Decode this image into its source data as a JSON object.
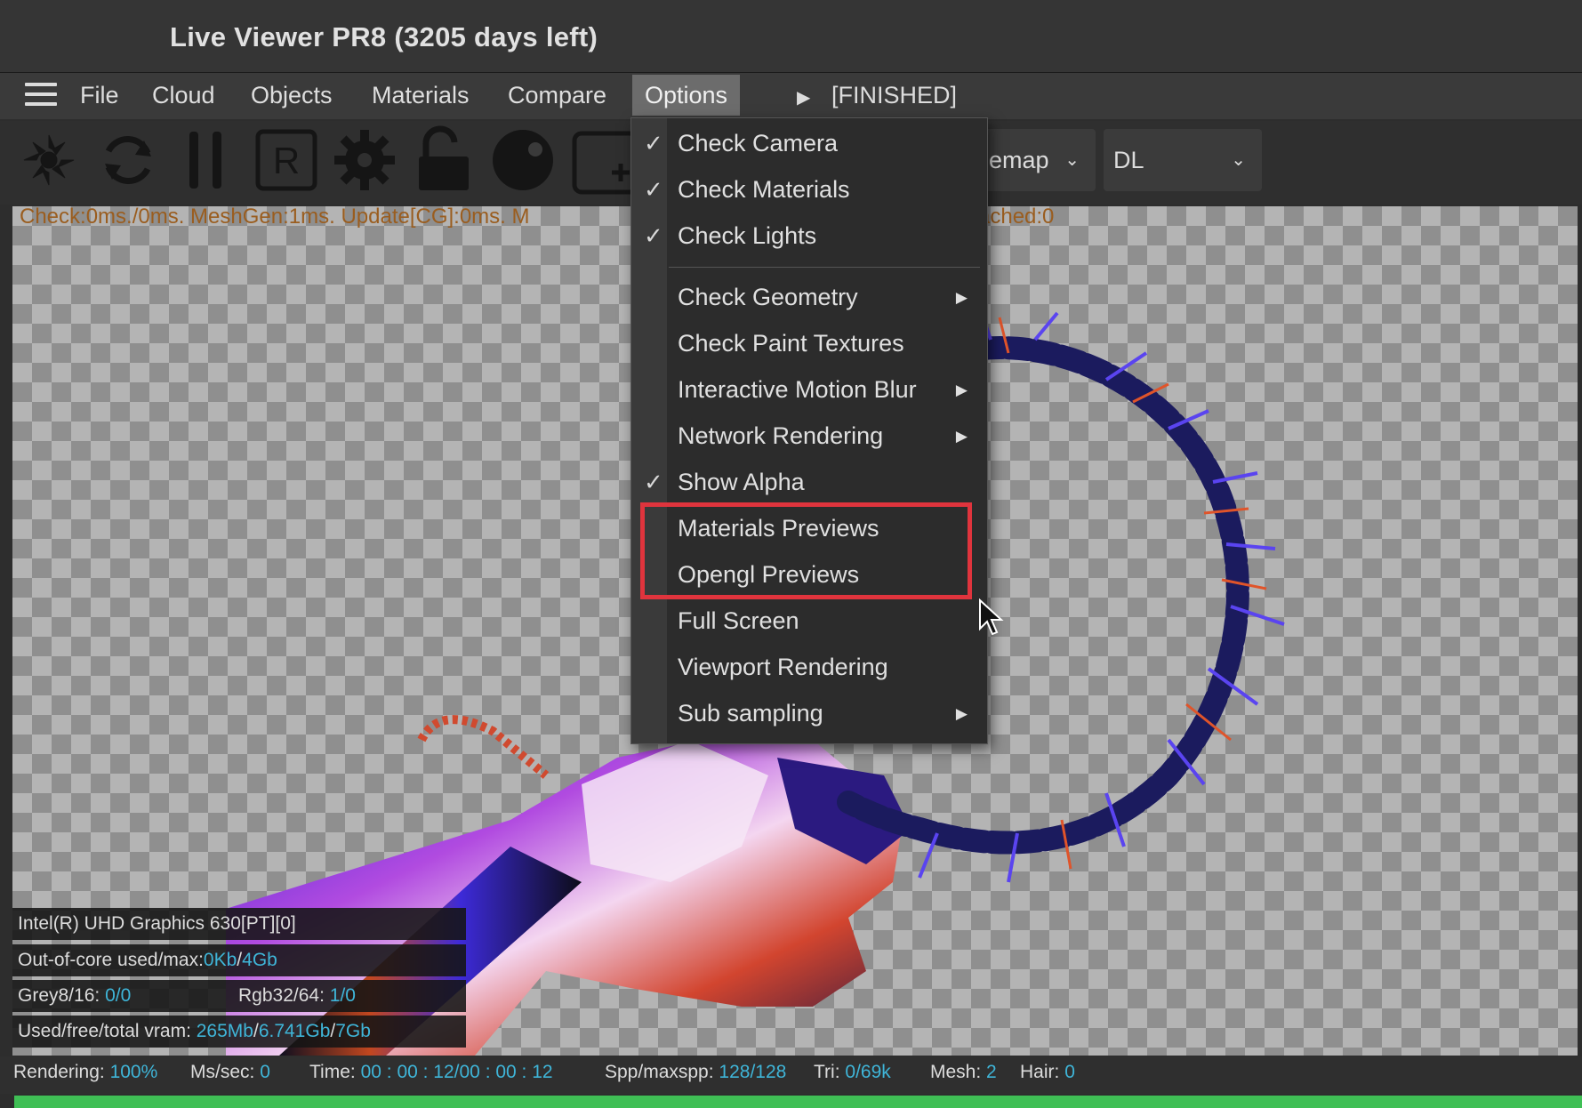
{
  "window": {
    "title": "Live Viewer PR8 (3205 days left)"
  },
  "menubar": {
    "items": [
      {
        "label": "File"
      },
      {
        "label": "Cloud"
      },
      {
        "label": "Objects"
      },
      {
        "label": "Materials"
      },
      {
        "label": "Compare"
      },
      {
        "label": "Options"
      }
    ],
    "active_item": "Options",
    "status": "[FINISHED]"
  },
  "toolbar": {
    "tools": [
      "reset-icon",
      "refresh-icon",
      "pause-icon",
      "region-render-icon",
      "settings-gear-icon",
      "unlock-icon",
      "material-ball-icon",
      "add-icon"
    ],
    "kernel_dropdown": {
      "value": "emap"
    },
    "mode_dropdown": {
      "value": "DL"
    }
  },
  "stats_top": "Check:0ms./0ms. MeshGen:1ms. Update[CG]:0ms. M",
  "stats_top_tail": "ached:0",
  "options_menu": {
    "items": [
      {
        "label": "Check Camera",
        "checked": true,
        "submenu": false
      },
      {
        "label": "Check Materials",
        "checked": true,
        "submenu": false
      },
      {
        "label": "Check Lights",
        "checked": true,
        "submenu": false
      },
      {
        "label": "Check Geometry",
        "checked": false,
        "submenu": true
      },
      {
        "label": "Check Paint Textures",
        "checked": false,
        "submenu": false
      },
      {
        "label": "Interactive Motion Blur",
        "checked": false,
        "submenu": true
      },
      {
        "label": "Network Rendering",
        "checked": false,
        "submenu": true
      },
      {
        "label": "Show Alpha",
        "checked": true,
        "submenu": false
      },
      {
        "label": "Materials Previews",
        "checked": false,
        "submenu": false
      },
      {
        "label": "Opengl Previews",
        "checked": false,
        "submenu": false
      },
      {
        "label": "Full Screen",
        "checked": false,
        "submenu": false
      },
      {
        "label": "Viewport Rendering",
        "checked": false,
        "submenu": false
      },
      {
        "label": "Sub sampling",
        "checked": false,
        "submenu": true
      }
    ],
    "highlighted": [
      "Materials Previews",
      "Opengl Previews"
    ],
    "highlight_color": "#e0343d"
  },
  "info": {
    "gpu": "Intel(R) UHD Graphics 630[PT][0]",
    "out_of_core_label": "Out-of-core used/max:",
    "out_of_core_used": "0Kb",
    "out_of_core_max": "4Gb",
    "grey_label": "Grey8/16:",
    "grey_value": "0/0",
    "rgb_label": "Rgb32/64:",
    "rgb_value": "1/0",
    "vram_label": "Used/free/total vram:",
    "vram_used": "265Mb",
    "vram_free": "6.741Gb",
    "vram_total": "7Gb"
  },
  "status_bar": {
    "rendering_label": "Rendering:",
    "rendering_value": "100%",
    "ms_label": "Ms/sec:",
    "ms_value": "0",
    "time_label": "Time:",
    "time_value": "00 : 00 : 12/00 : 00 : 12",
    "spp_label": "Spp/maxspp:",
    "spp_value": "128/128",
    "tri_label": "Tri:",
    "tri_value": "0/69k",
    "mesh_label": "Mesh:",
    "mesh_value": "2",
    "hair_label": "Hair:",
    "hair_value": "0",
    "progress": 1.0
  },
  "colors": {
    "accent_value": "#3fb5d8",
    "progress": "#3fbf55",
    "stats_warning": "#9a5d1f"
  }
}
